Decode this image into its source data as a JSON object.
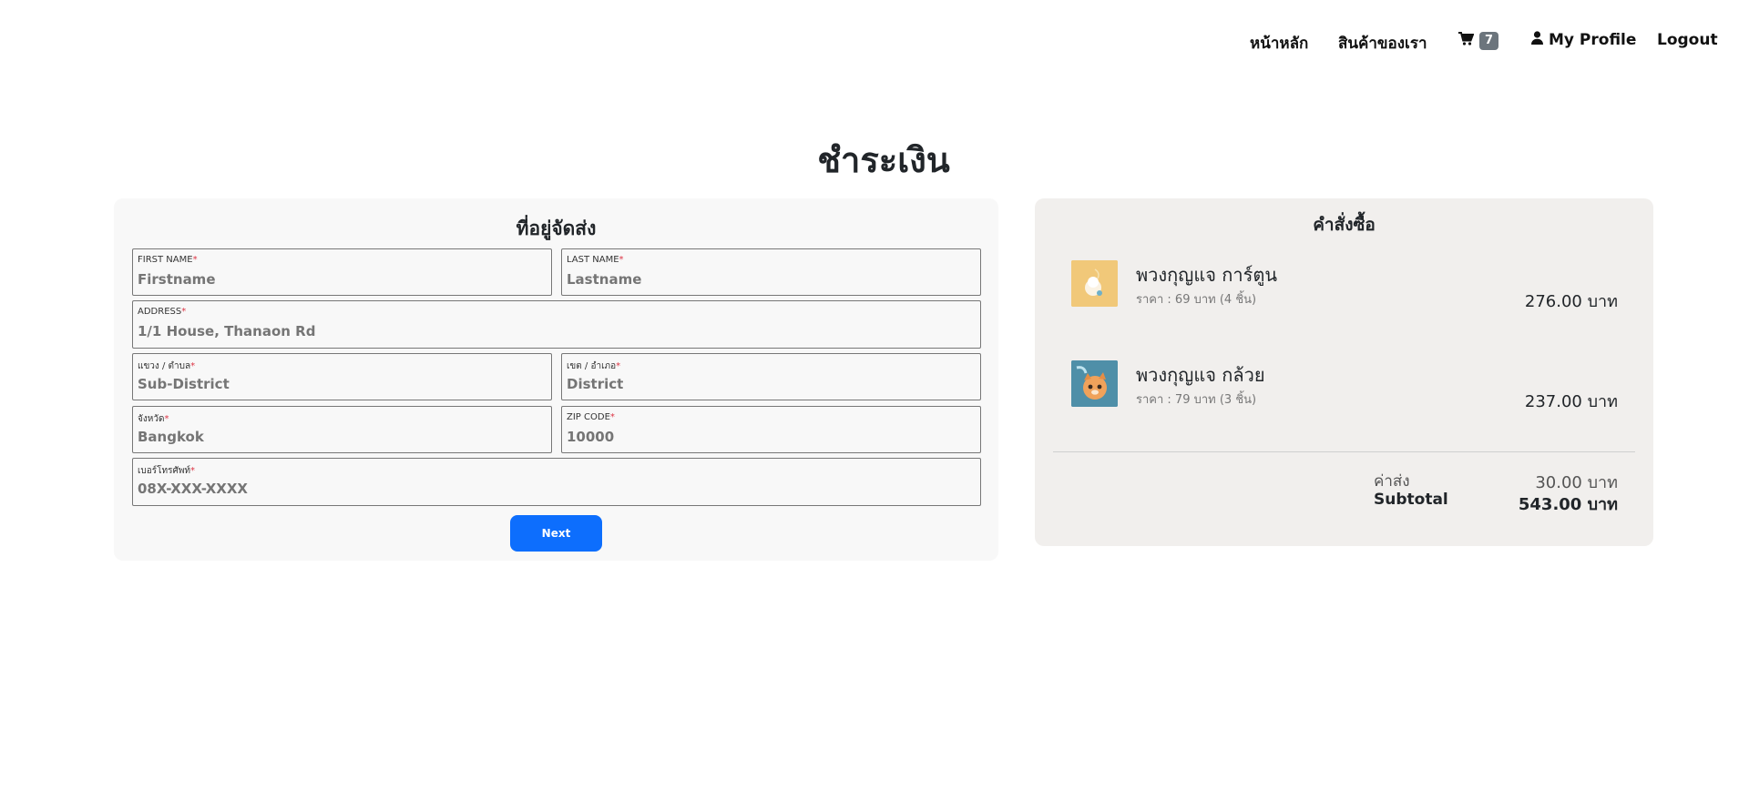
{
  "nav": {
    "home": "หน้าหลัก",
    "products": "สินค้าของเรา",
    "cart_count": "7",
    "profile": "My Profile",
    "logout": "Logout"
  },
  "page_title": "ชำระเงิน",
  "shipping": {
    "title": "ที่อยู่จัดส่ง",
    "fields": {
      "first_name": {
        "label": "FIRST NAME",
        "placeholder": "Firstname",
        "value": ""
      },
      "last_name": {
        "label": "LAST NAME",
        "placeholder": "Lastname",
        "value": ""
      },
      "address": {
        "label": "ADDRESS",
        "placeholder": "1/1 House, Thanaon Rd",
        "value": ""
      },
      "sub_district": {
        "label": "แขวง / ตำบล",
        "placeholder": "Sub-District",
        "value": ""
      },
      "district": {
        "label": "เขต / อำเภอ",
        "placeholder": "District",
        "value": ""
      },
      "province": {
        "label": "จังหวัด",
        "placeholder": "Bangkok",
        "value": ""
      },
      "zip": {
        "label": "ZIP CODE",
        "placeholder": "10000",
        "value": ""
      },
      "phone": {
        "label": "เบอร์โทรศัพท์",
        "placeholder": "08X-XXX-XXXX",
        "value": ""
      }
    },
    "required_mark": "*",
    "next_label": "Next"
  },
  "order": {
    "title": "คำสั่งซื้อ",
    "items": [
      {
        "name": "พวงกุญแจ การ์ตูน",
        "meta": "ราคา : 69 บาท (4 ชิ้น)",
        "total": "276.00 บาท"
      },
      {
        "name": "พวงกุญแจ กล้วย",
        "meta": "ราคา : 79 บาท (3 ชิ้น)",
        "total": "237.00 บาท"
      }
    ],
    "shipping_label": "ค่าส่ง",
    "shipping_value": "30.00 บาท",
    "subtotal_label": "Subtotal",
    "subtotal_value": "543.00 บาท"
  },
  "colors": {
    "primary_button": "#0d6efd",
    "required": "#dc3545",
    "cart_badge": "#6c757d"
  },
  "icons": {
    "cart": "shopping-cart-icon",
    "profile": "user-icon"
  }
}
